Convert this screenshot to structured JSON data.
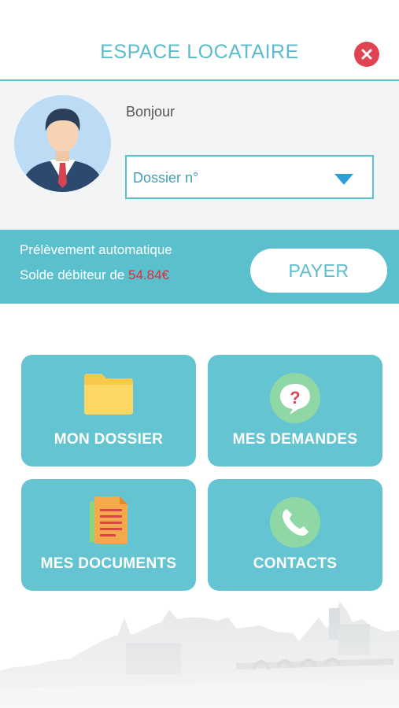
{
  "header": {
    "title": "ESPACE LOCATAIRE",
    "close_icon": "close-icon"
  },
  "profile": {
    "greeting": "Bonjour",
    "dossier_select": {
      "value": "Dossier n°"
    },
    "avatar_icon": "user-avatar-icon"
  },
  "payment": {
    "line1": "Prélèvement automatique",
    "line2_prefix": "Solde débiteur de",
    "amount": "54.84€",
    "pay_label": "PAYER"
  },
  "tiles": [
    {
      "label": "MON DOSSIER",
      "icon": "folder-icon"
    },
    {
      "label": "MES DEMANDES",
      "icon": "question-bubble-icon"
    },
    {
      "label": "MES DOCUMENTS",
      "icon": "documents-icon"
    },
    {
      "label": "CONTACTS",
      "icon": "phone-icon"
    }
  ],
  "colors": {
    "accent": "#5bc0ce",
    "tile": "#65c4d1",
    "close": "#e04452",
    "amount": "#e02a3a"
  }
}
